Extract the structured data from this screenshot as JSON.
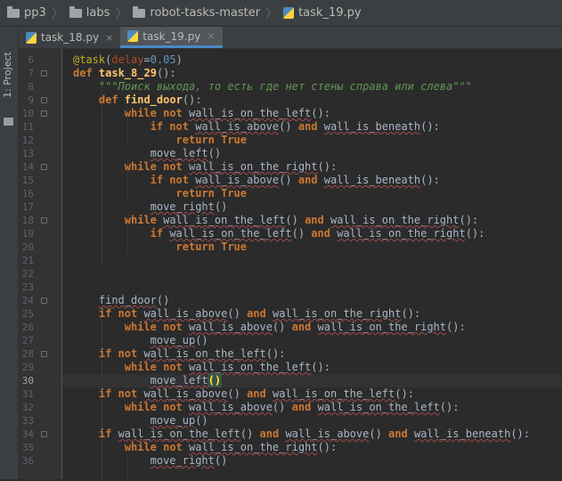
{
  "breadcrumb": [
    "pp3",
    "labs",
    "robot-tasks-master",
    "task_19.py"
  ],
  "tool_window_label": "1: Project",
  "tabs": [
    {
      "label": "task_18.py",
      "close": "×"
    },
    {
      "label": "task_19.py",
      "close": "×"
    }
  ],
  "active_tab": 1,
  "current_line": 30,
  "lines": [
    {
      "n": "6",
      "indent": 0,
      "tokens": [
        [
          "dec",
          "@task"
        ],
        [
          "p",
          "("
        ],
        [
          "par",
          "delay"
        ],
        [
          "p",
          "="
        ],
        [
          "num",
          "0.05"
        ],
        [
          "p",
          ")"
        ]
      ]
    },
    {
      "n": "7",
      "indent": 0,
      "tokens": [
        [
          "kw",
          "def "
        ],
        [
          "fn",
          "task_8_29"
        ],
        [
          "p",
          "():"
        ]
      ]
    },
    {
      "n": "8",
      "indent": 1,
      "tokens": [
        [
          "str",
          "\"\"\"Поиск выхода, то есть где нет стены справа или слева\"\"\""
        ]
      ]
    },
    {
      "n": "9",
      "indent": 1,
      "tokens": [
        [
          "kw",
          "def "
        ],
        [
          "fn",
          "find_door"
        ],
        [
          "p",
          "():"
        ]
      ]
    },
    {
      "n": "10",
      "indent": 2,
      "tokens": [
        [
          "kw",
          "while not "
        ],
        [
          "uw",
          "wall_is_on_the_left"
        ],
        [
          "p",
          "():"
        ]
      ]
    },
    {
      "n": "11",
      "indent": 3,
      "tokens": [
        [
          "kw",
          "if not "
        ],
        [
          "uw",
          "wall_is_above"
        ],
        [
          "p",
          "() "
        ],
        [
          "kw",
          "and "
        ],
        [
          "uw",
          "wall_is_beneath"
        ],
        [
          "p",
          "():"
        ]
      ]
    },
    {
      "n": "12",
      "indent": 4,
      "tokens": [
        [
          "kw",
          "return True"
        ]
      ]
    },
    {
      "n": "13",
      "indent": 3,
      "tokens": [
        [
          "uw",
          "move_left"
        ],
        [
          "p",
          "()"
        ]
      ]
    },
    {
      "n": "14",
      "indent": 2,
      "tokens": [
        [
          "kw",
          "while not "
        ],
        [
          "uw",
          "wall_is_on_the_right"
        ],
        [
          "p",
          "():"
        ]
      ]
    },
    {
      "n": "15",
      "indent": 3,
      "tokens": [
        [
          "kw",
          "if not "
        ],
        [
          "uw",
          "wall_is_above"
        ],
        [
          "p",
          "() "
        ],
        [
          "kw",
          "and "
        ],
        [
          "uw",
          "wall_is_beneath"
        ],
        [
          "p",
          "():"
        ]
      ]
    },
    {
      "n": "16",
      "indent": 4,
      "tokens": [
        [
          "kw",
          "return True"
        ]
      ]
    },
    {
      "n": "17",
      "indent": 3,
      "tokens": [
        [
          "uw",
          "move_right"
        ],
        [
          "p",
          "()"
        ]
      ]
    },
    {
      "n": "18",
      "indent": 2,
      "tokens": [
        [
          "kw",
          "while "
        ],
        [
          "uw",
          "wall_is_on_the_left"
        ],
        [
          "p",
          "() "
        ],
        [
          "kw",
          "and "
        ],
        [
          "uw",
          "wall_is_on_the_right"
        ],
        [
          "p",
          "():"
        ]
      ]
    },
    {
      "n": "19",
      "indent": 3,
      "tokens": [
        [
          "kw",
          "if "
        ],
        [
          "uw",
          "wall_is_on_the_left"
        ],
        [
          "p",
          "() "
        ],
        [
          "kw",
          "and "
        ],
        [
          "uw",
          "wall_is_on_the_right"
        ],
        [
          "p",
          "():"
        ]
      ]
    },
    {
      "n": "20",
      "indent": 4,
      "tokens": [
        [
          "kw",
          "return True"
        ]
      ]
    },
    {
      "n": "21",
      "indent": 0,
      "tokens": []
    },
    {
      "n": "22",
      "indent": 0,
      "tokens": []
    },
    {
      "n": "23",
      "indent": 0,
      "tokens": []
    },
    {
      "n": "24",
      "indent": 1,
      "tokens": [
        [
          "uw",
          "find_door"
        ],
        [
          "p",
          "()"
        ]
      ]
    },
    {
      "n": "25",
      "indent": 1,
      "tokens": [
        [
          "kw",
          "if not "
        ],
        [
          "uw",
          "wall_is_above"
        ],
        [
          "p",
          "() "
        ],
        [
          "kw",
          "and "
        ],
        [
          "uw",
          "wall_is_on_the_right"
        ],
        [
          "p",
          "():"
        ]
      ]
    },
    {
      "n": "26",
      "indent": 2,
      "tokens": [
        [
          "kw",
          "while not "
        ],
        [
          "uw",
          "wall_is_above"
        ],
        [
          "p",
          "() "
        ],
        [
          "kw",
          "and "
        ],
        [
          "uw",
          "wall_is_on_the_right"
        ],
        [
          "p",
          "():"
        ]
      ]
    },
    {
      "n": "27",
      "indent": 3,
      "tokens": [
        [
          "uw",
          "move_up"
        ],
        [
          "p",
          "()"
        ]
      ]
    },
    {
      "n": "28",
      "indent": 1,
      "tokens": [
        [
          "kw",
          "if not "
        ],
        [
          "uw",
          "wall_is_on_the_left"
        ],
        [
          "p",
          "():"
        ]
      ]
    },
    {
      "n": "29",
      "indent": 2,
      "tokens": [
        [
          "kw",
          "while not "
        ],
        [
          "uw",
          "wall_is_on_the_left"
        ],
        [
          "p",
          "():"
        ]
      ]
    },
    {
      "n": "30",
      "indent": 3,
      "tokens": [
        [
          "uw",
          "move_left"
        ],
        [
          "hl",
          "()"
        ]
      ]
    },
    {
      "n": "31",
      "indent": 1,
      "tokens": [
        [
          "kw",
          "if not "
        ],
        [
          "uw",
          "wall_is_above"
        ],
        [
          "p",
          "() "
        ],
        [
          "kw",
          "and "
        ],
        [
          "uw",
          "wall_is_on_the_left"
        ],
        [
          "p",
          "():"
        ]
      ]
    },
    {
      "n": "32",
      "indent": 2,
      "tokens": [
        [
          "kw",
          "while not "
        ],
        [
          "uw",
          "wall_is_above"
        ],
        [
          "p",
          "() "
        ],
        [
          "kw",
          "and "
        ],
        [
          "uw",
          "wall_is_on_the_left"
        ],
        [
          "p",
          "():"
        ]
      ]
    },
    {
      "n": "33",
      "indent": 3,
      "tokens": [
        [
          "uw",
          "move_up"
        ],
        [
          "p",
          "()"
        ]
      ]
    },
    {
      "n": "34",
      "indent": 1,
      "tokens": [
        [
          "kw",
          "if "
        ],
        [
          "uw",
          "wall_is_on_the_left"
        ],
        [
          "p",
          "() "
        ],
        [
          "kw",
          "and "
        ],
        [
          "uw",
          "wall_is_above"
        ],
        [
          "p",
          "() "
        ],
        [
          "kw",
          "and "
        ],
        [
          "uw",
          "wall_is_beneath"
        ],
        [
          "p",
          "():"
        ]
      ]
    },
    {
      "n": "35",
      "indent": 2,
      "tokens": [
        [
          "kw",
          "while not "
        ],
        [
          "uw",
          "wall_is_on_the_right"
        ],
        [
          "p",
          "():"
        ]
      ]
    },
    {
      "n": "36",
      "indent": 3,
      "tokens": [
        [
          "uw",
          "move_right"
        ],
        [
          "p",
          "()"
        ]
      ]
    }
  ],
  "folds": [
    "7",
    "9",
    "10",
    "14",
    "18",
    "24",
    "28",
    "34"
  ],
  "colors": {
    "background": "#2b2b2b",
    "keyword": "#cc7832",
    "function": "#ffc66d",
    "string": "#629755",
    "decorator": "#bbb529",
    "number": "#6897bb",
    "param": "#aa4926",
    "text": "#a9b7c6"
  }
}
